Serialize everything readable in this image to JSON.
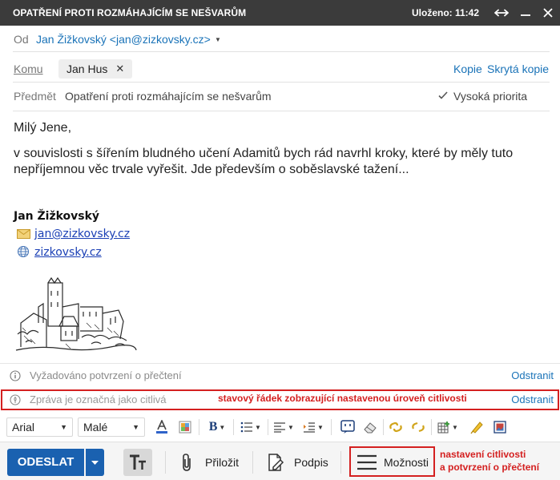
{
  "window": {
    "title": "OPATŘENÍ PROTI ROZMÁHAJÍCÍM SE NEŠVARŮM",
    "saved_status": "Uloženo: 11:42"
  },
  "header": {
    "from_label": "Od",
    "from_value": "Jan Žižkovský <jan@zizkovsky.cz>",
    "to_label": "Komu",
    "recipients": [
      {
        "name": "Jan Hus"
      }
    ],
    "cc_link": "Kopie",
    "bcc_link": "Skrytá kopie",
    "subject_label": "Předmět",
    "subject_value": "Opatření proti rozmáhajícím se nešvarům",
    "high_priority_label": "Vysoká priorita",
    "high_priority_checked": true
  },
  "body": {
    "greeting": "Milý Jene,",
    "paragraph_line1": "v souvislosti s šířením bludného učení Adamitů bych rád navrhl kroky, které by měly tuto",
    "paragraph_line2": "nepříjemnou věc trvale vyřešit. Jde především o soběslavské tažení..."
  },
  "signature": {
    "name": "Jan Žižkovský",
    "email": "jan@zizkovsky.cz",
    "website": "zizkovsky.cz"
  },
  "notices": {
    "read_receipt": {
      "text": "Vyžadováno potvrzení o přečtení",
      "action": "Odstranit"
    },
    "sensitivity": {
      "text": "Zpráva je označná jako citlivá",
      "action": "Odstranit"
    }
  },
  "annotations": {
    "status_note": "stavový řádek zobrazující nastavenou úroveň citlivosti",
    "options_note_line1": "nastavení citlivosti",
    "options_note_line2": "a potvrzení o přečtení"
  },
  "format_toolbar": {
    "font": "Arial",
    "size": "Malé"
  },
  "bottom_toolbar": {
    "send": "ODESLAT",
    "attach": "Přiložit",
    "signature": "Podpis",
    "options": "Možnosti"
  },
  "colors": {
    "titlebar": "#3b3b3b",
    "accent_blue": "#1a61b0",
    "link_blue": "#1a73b8",
    "highlight_red": "#d42020"
  }
}
